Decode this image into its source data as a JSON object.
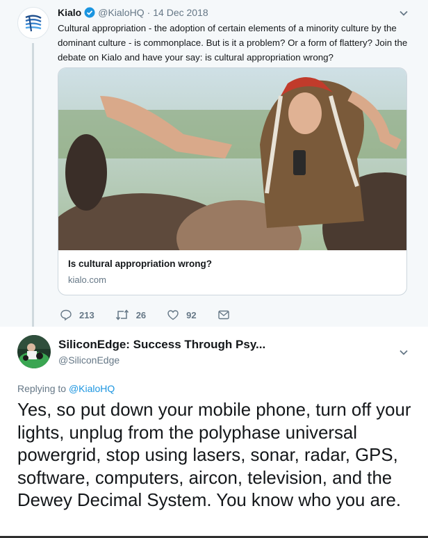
{
  "parent_tweet": {
    "author_name": "Kialo",
    "handle": "@KialoHQ",
    "separator": "·",
    "date": "14 Dec 2018",
    "text": "Cultural appropriation - the adoption of certain elements of a minority culture by the dominant culture - is commonplace. But is it a problem? Or a form of flattery? Join the debate on Kialo and have your say: is cultural appropriation wrong?",
    "card": {
      "title": "Is cultural appropriation wrong?",
      "domain": "kialo.com"
    },
    "actions": {
      "replies": "213",
      "retweets": "26",
      "likes": "92"
    }
  },
  "reply_tweet": {
    "author_name": "SiliconEdge: Success Through Psy...",
    "handle": "@SiliconEdge",
    "replying_prefix": "Replying to",
    "replying_handle": "@KialoHQ",
    "text": "Yes, so put down your mobile phone, turn off your lights, unplug from the polyphase universal powergrid, stop using lasers, sonar, radar, GPS, software, computers, aircon, television, and the Dewey Decimal System. You know who you are."
  },
  "colors": {
    "accent": "#1b95e0",
    "secondary_text": "#657786",
    "parent_background": "#f5f8fa"
  },
  "icons": [
    "kialo-logo-icon",
    "verified-icon",
    "chevron-down-icon",
    "reply-icon",
    "retweet-icon",
    "like-icon",
    "message-icon"
  ]
}
